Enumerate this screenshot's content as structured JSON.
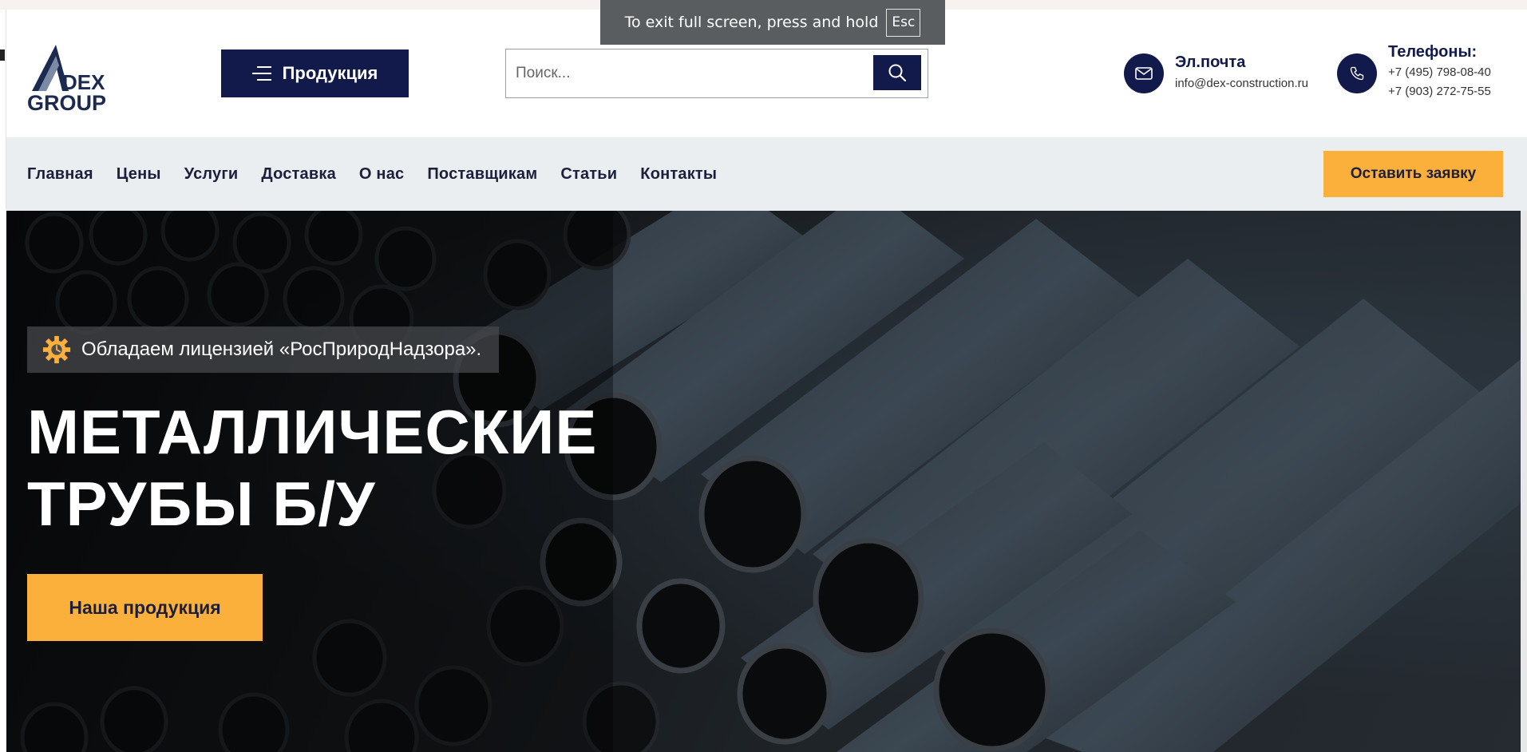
{
  "fullscreen_notice": {
    "text": "To exit full screen, press and hold",
    "key": "Esc"
  },
  "header": {
    "logo_alt": "DEX GROUP",
    "products_label": "Продукция",
    "search_placeholder": "Поиск...",
    "email": {
      "title": "Эл.почта",
      "value": "info@dex-construction.ru"
    },
    "phones": {
      "title": "Телефоны:",
      "values": [
        "+7 (495) 798-08-40",
        "+7 (903) 272-75-55"
      ]
    }
  },
  "nav": {
    "items": [
      "Главная",
      "Цены",
      "Услуги",
      "Доставка",
      "О нас",
      "Поставщикам",
      "Статьи",
      "Контакты"
    ],
    "cta_label": "Оставить заявку"
  },
  "hero": {
    "badge": "Обладаем лицензией «РосПриродНадзора».",
    "title_lines": [
      "МЕТАЛЛИЧЕСКИЕ",
      "ТРУБЫ Б/У"
    ],
    "button_label": "Наша продукция"
  },
  "colors": {
    "navy": "#111a4a",
    "accent": "#fbb03b",
    "nav_bg": "#ebeef1"
  }
}
